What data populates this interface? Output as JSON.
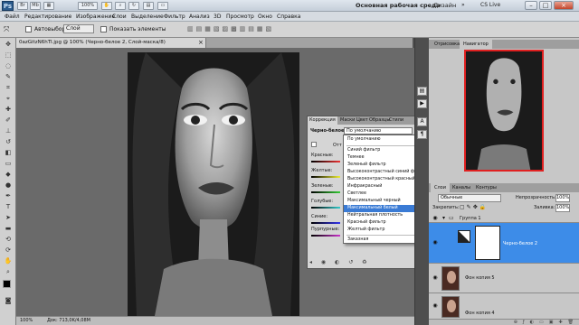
{
  "app": {
    "logo": "Ps",
    "workspace": "Основная рабочая среда",
    "design": "Дизайн",
    "cslive": "CS Live",
    "zoom": "100%",
    "min": "–",
    "max": "□",
    "close": "×"
  },
  "menu": [
    "Файл",
    "Редактирование",
    "Изображение",
    "Слои",
    "Выделение",
    "Фильтр",
    "Анализ",
    "3D",
    "Просмотр",
    "Окно",
    "Справка"
  ],
  "options": {
    "autoselect": "Автовыбор:",
    "autoselect_value": "Слой",
    "show_controls": "Показать элементы"
  },
  "document": {
    "tab": "0azGitzN6hTI.jpg @ 100% (Черно-белое 2, Слой-маска/8)",
    "tab_close": "×"
  },
  "status": {
    "zoom": "100%",
    "doc": "Док: 713,0K/4,08M"
  },
  "adjustments": {
    "tabs": [
      "Коррекция",
      "Маски",
      "Цвет",
      "Образцы",
      "Стили"
    ],
    "preset_label": "Черно-белое",
    "preset_value": "По умолчанию",
    "tint": "Отт",
    "channels": [
      "Красные:",
      "Желтые:",
      "Зеленые:",
      "Голубые:",
      "Синие:",
      "Пурпурные:"
    ]
  },
  "preset_menu": [
    "По умолчанию",
    "Синий фильтр",
    "Темнее",
    "Зеленый фильтр",
    "Высококонтрастный синий фильтр",
    "Высококонтрастный красный фильтр",
    "Инфракрасный",
    "Светлее",
    "Максимальный черный",
    "Максимальный белый",
    "Нейтральная плотность",
    "Красный фильтр",
    "Желтый фильтр",
    "Заказная"
  ],
  "preset_highlight_index": 9,
  "navigator": {
    "tabs": [
      "Отрисовка",
      "Навигатор"
    ]
  },
  "layers": {
    "tabs": [
      "Слои",
      "Каналы",
      "Контуры"
    ],
    "blend_mode": "Обычные",
    "opacity_label": "Непрозрачность:",
    "opacity": "100%",
    "lock_label": "Закрепить:",
    "fill_label": "Заливка:",
    "fill": "100%",
    "group": "Группа 1",
    "items": [
      "Черно-белое 2",
      "Фон копия 5",
      "Фон копия 4"
    ]
  }
}
